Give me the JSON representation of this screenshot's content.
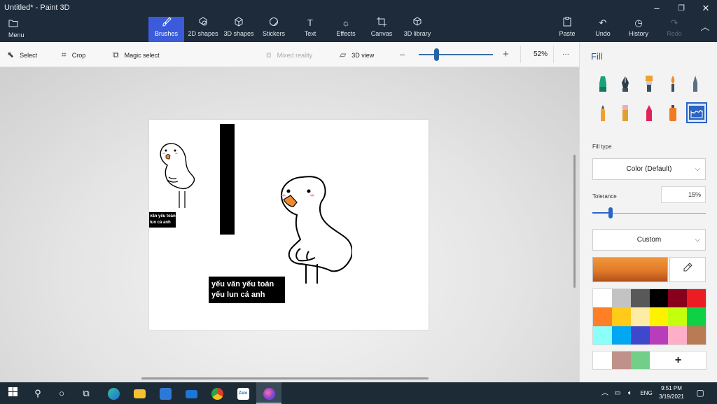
{
  "window": {
    "title": "Untitled* - Paint 3D",
    "minimize": "–",
    "maximize": "❐",
    "close": "✕"
  },
  "ribbon": {
    "menu": {
      "label": "Menu",
      "icon": "folder-icon"
    },
    "tools": [
      {
        "label": "Brushes",
        "icon": "brush-icon",
        "active": true
      },
      {
        "label": "2D shapes",
        "icon": "2d-shapes-icon"
      },
      {
        "label": "3D shapes",
        "icon": "3d-shapes-icon"
      },
      {
        "label": "Stickers",
        "icon": "stickers-icon"
      },
      {
        "label": "Text",
        "icon": "text-icon"
      },
      {
        "label": "Effects",
        "icon": "effects-icon"
      },
      {
        "label": "Canvas",
        "icon": "canvas-icon"
      },
      {
        "label": "3D library",
        "icon": "3d-library-icon"
      }
    ],
    "right": [
      {
        "label": "Paste",
        "icon": "paste-icon"
      },
      {
        "label": "Undo",
        "icon": "undo-icon"
      },
      {
        "label": "History",
        "icon": "history-icon"
      },
      {
        "label": "Redo",
        "icon": "redo-icon",
        "disabled": true
      }
    ]
  },
  "toolbar": {
    "select": "Select",
    "crop": "Crop",
    "magic_select": "Magic select",
    "mixed_reality": "Mixed reality",
    "view_3d": "3D view",
    "zoom": "52%",
    "zoom_level": 0.52,
    "more": "···"
  },
  "canvas": {
    "caption_small": [
      "vân yếu toán",
      "lun cả anh"
    ],
    "caption_big": [
      "yếu văn yếu toán",
      "yếu lun cả anh"
    ]
  },
  "panel": {
    "title": "Fill",
    "fill_type_label": "Fill type",
    "fill_type_value": "Color (Default)",
    "tolerance_label": "Tolerance",
    "tolerance_value": "15%",
    "color_mode": "Custom",
    "current_color": "#e07a2a",
    "palette": [
      "#ffffff",
      "#c3c3c3",
      "#585858",
      "#000000",
      "#88001b",
      "#ec1c24",
      "#ff7f27",
      "#ffca18",
      "#fdeca6",
      "#fff200",
      "#c4ff0e",
      "#0ed145",
      "#8cfffb",
      "#00a8f3",
      "#3f48cc",
      "#b83dba",
      "#ffaec8",
      "#b97a56"
    ],
    "custom_colors": [
      "#ffffff",
      "#bf918a",
      "#72cf88"
    ],
    "add_color": "+"
  },
  "taskbar": {
    "time": "9:51 PM",
    "date": "3/19/2021",
    "lang": "ENG",
    "zalo": "Zalo"
  }
}
